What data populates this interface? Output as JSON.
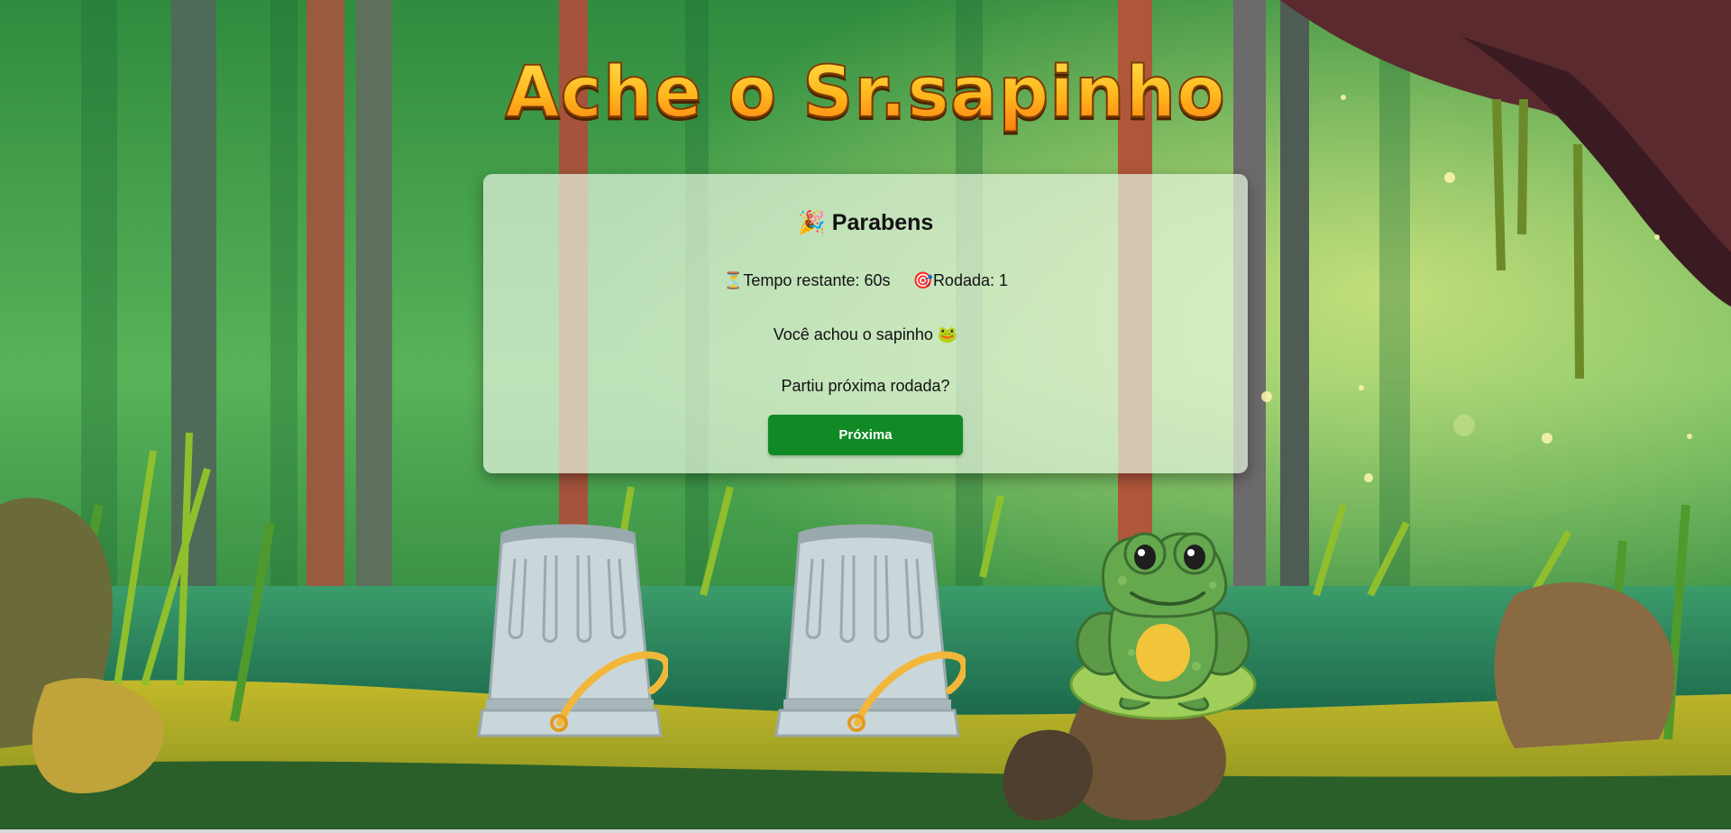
{
  "game": {
    "title": "Ache o Sr.sapinho"
  },
  "panel": {
    "heading_icon": "🎉",
    "heading": "Parabens",
    "timer_icon": "⏳",
    "timer_text": "Tempo restante: 60s",
    "round_icon": "🎯",
    "round_text": "Rodada: 1",
    "message": "Você achou o sapinho 🐸",
    "prompt": "Partiu próxima rodada?",
    "next_button": "Próxima"
  },
  "board": {
    "slots": [
      {
        "content": "bucket"
      },
      {
        "content": "bucket"
      },
      {
        "content": "frog"
      }
    ]
  },
  "colors": {
    "title_fill": "#ffb21a",
    "title_outline": "#7a3a05",
    "button": "#118a26",
    "panel": "#e4f4de"
  },
  "icons": [
    "party-popper-icon",
    "hourglass-icon",
    "target-icon",
    "frog-emoji-icon",
    "bucket-icon",
    "frog-icon"
  ]
}
